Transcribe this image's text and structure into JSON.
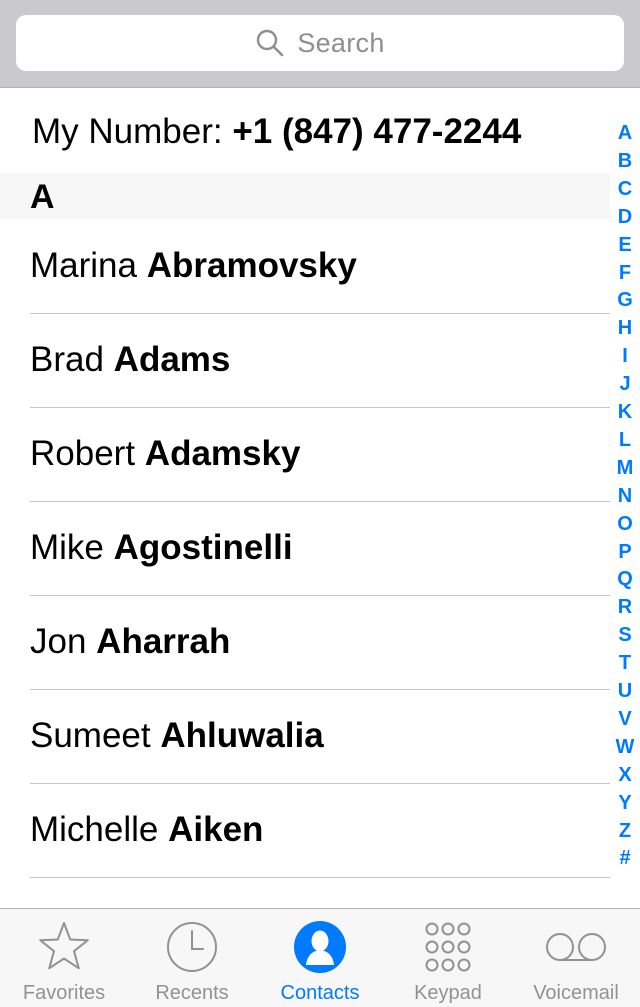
{
  "search": {
    "placeholder": "Search"
  },
  "my_number": {
    "label": "My Number:",
    "value": "+1 (847) 477-2244"
  },
  "section": {
    "letter": "A"
  },
  "contacts": [
    {
      "first": "Marina",
      "last": "Abramovsky"
    },
    {
      "first": "Brad",
      "last": "Adams"
    },
    {
      "first": "Robert",
      "last": "Adamsky"
    },
    {
      "first": "Mike",
      "last": "Agostinelli"
    },
    {
      "first": "Jon",
      "last": "Aharrah"
    },
    {
      "first": "Sumeet",
      "last": "Ahluwalia"
    },
    {
      "first": "Michelle",
      "last": "Aiken"
    }
  ],
  "index": [
    "A",
    "B",
    "C",
    "D",
    "E",
    "F",
    "G",
    "H",
    "I",
    "J",
    "K",
    "L",
    "M",
    "N",
    "O",
    "P",
    "Q",
    "R",
    "S",
    "T",
    "U",
    "V",
    "W",
    "X",
    "Y",
    "Z",
    "#"
  ],
  "tabs": [
    {
      "label": "Favorites",
      "icon": "star-icon",
      "active": false
    },
    {
      "label": "Recents",
      "icon": "clock-icon",
      "active": false
    },
    {
      "label": "Contacts",
      "icon": "person-icon",
      "active": true
    },
    {
      "label": "Keypad",
      "icon": "keypad-icon",
      "active": false
    },
    {
      "label": "Voicemail",
      "icon": "voicemail-icon",
      "active": false
    }
  ],
  "colors": {
    "accent": "#007aff",
    "inactive_tab": "#929292",
    "search_bar_bg": "#c9c9ce",
    "section_bg": "#f7f7f7",
    "separator": "#c8c7cc"
  }
}
